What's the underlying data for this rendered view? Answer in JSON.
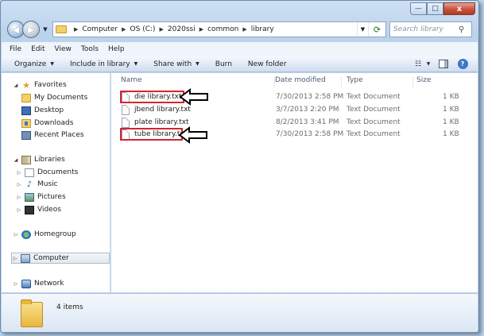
{
  "window": {
    "caption_buttons": [
      "—",
      "□",
      "x"
    ]
  },
  "navbar": {
    "back_glyph": "◀",
    "forward_glyph": "▶",
    "breadcrumb": [
      "Computer",
      "OS (C:)",
      "2020ssi",
      "common",
      "library"
    ],
    "search_placeholder": "Search library",
    "search_icon": "magnifier-icon",
    "refresh_icon": "refresh-icon"
  },
  "menubar": [
    "File",
    "Edit",
    "View",
    "Tools",
    "Help"
  ],
  "toolbar": {
    "organize": "Organize",
    "include_in_library": "Include in library",
    "share_with": "Share with",
    "burn": "Burn",
    "new_folder": "New folder"
  },
  "navpane": {
    "favorites": {
      "label": "Favorites",
      "items": [
        "My Documents",
        "Desktop",
        "Downloads",
        "Recent Places"
      ]
    },
    "libraries": {
      "label": "Libraries",
      "items": [
        "Documents",
        "Music",
        "Pictures",
        "Videos"
      ]
    },
    "homegroup": "Homegroup",
    "computer": "Computer",
    "network": "Network"
  },
  "columns": [
    "Name",
    "Date modified",
    "Type",
    "Size"
  ],
  "files": [
    {
      "name": "die library.txt",
      "date": "7/30/2013 2:58 PM",
      "type": "Text Document",
      "size": "1 KB",
      "highlighted": true
    },
    {
      "name": "jbend library.txt",
      "date": "3/7/2013 2:20 PM",
      "type": "Text Document",
      "size": "1 KB",
      "highlighted": false
    },
    {
      "name": "plate library.txt",
      "date": "8/2/2013 3:41 PM",
      "type": "Text Document",
      "size": "1 KB",
      "highlighted": false
    },
    {
      "name": "tube library.txt",
      "date": "7/30/2013 2:58 PM",
      "type": "Text Document",
      "size": "1 KB",
      "highlighted": true
    }
  ],
  "details": {
    "item_count": "4 items"
  },
  "colors": {
    "highlight_box": "#d2262e",
    "arrow_outline": "#000000"
  }
}
